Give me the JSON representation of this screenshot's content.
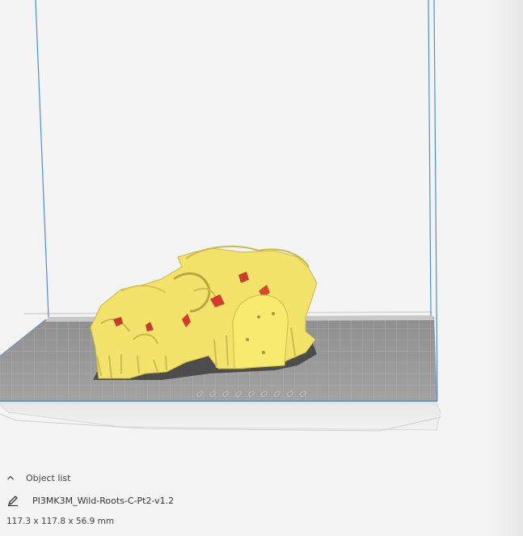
{
  "object_list": {
    "title": "Object list",
    "expanded_icon": "chevron-up-icon",
    "edit_icon": "pencil-icon",
    "item_name": "PI3MK3M_Wild-Roots-C-Pt2-v1.2"
  },
  "model_info": {
    "dimensions": "117.3 x 117.8 x 56.9 mm"
  },
  "colors": {
    "background": "#f4f4f4",
    "build_plate": "#9a9a9a",
    "build_volume_edge": "#4a90d9",
    "model": "#f5e66b",
    "model_overhang": "#d63a2a"
  }
}
